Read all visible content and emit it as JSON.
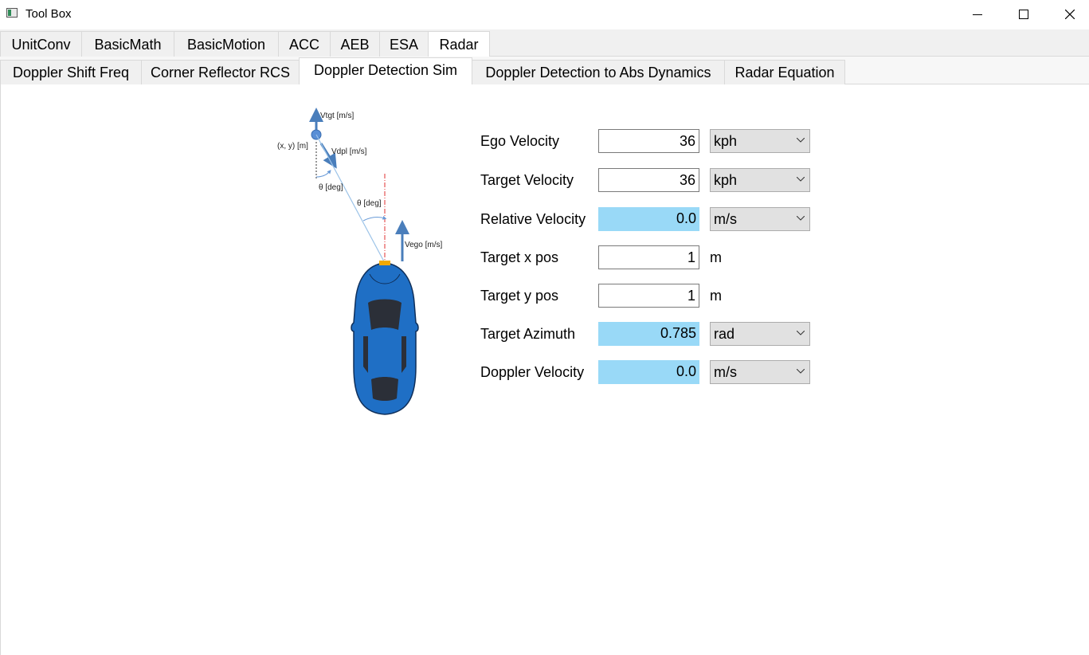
{
  "window": {
    "title": "Tool Box"
  },
  "main_tabs": [
    {
      "label": "UnitConv"
    },
    {
      "label": "BasicMath"
    },
    {
      "label": "BasicMotion"
    },
    {
      "label": "ACC"
    },
    {
      "label": "AEB"
    },
    {
      "label": "ESA"
    },
    {
      "label": "Radar",
      "active": true
    }
  ],
  "sub_tabs": [
    {
      "label": "Doppler Shift Freq"
    },
    {
      "label": "Corner Reflector RCS"
    },
    {
      "label": "Doppler Detection Sim",
      "active": true
    },
    {
      "label": "Doppler Detection to Abs Dynamics"
    },
    {
      "label": "Radar Equation"
    }
  ],
  "diagram": {
    "vtgt_label": "Vtgt [m/s]",
    "xy_label": "(x, y) [m]",
    "vdpl_label": "Vdpl [m/s]",
    "theta1_label": "θ [deg]",
    "theta2_label": "θ [deg]",
    "vego_label": "Vego [m/s]",
    "car_color": "#1f6fc5",
    "arrow_color": "#4a7ebb"
  },
  "form": {
    "ego_velocity": {
      "label": "Ego Velocity",
      "value": "36",
      "unit": "kph"
    },
    "target_velocity": {
      "label": "Target Velocity",
      "value": "36",
      "unit": "kph"
    },
    "relative_velocity": {
      "label": "Relative Velocity",
      "value": "0.0",
      "unit": "m/s"
    },
    "target_x": {
      "label": "Target x pos",
      "value": "1",
      "unit": "m"
    },
    "target_y": {
      "label": "Target y pos",
      "value": "1",
      "unit": "m"
    },
    "target_azimuth": {
      "label": "Target Azimuth",
      "value": "0.785",
      "unit": "rad"
    },
    "doppler_velocity": {
      "label": "Doppler Velocity",
      "value": "0.0",
      "unit": "m/s"
    }
  },
  "colors": {
    "readonly_field": "#99d9f7",
    "combo_bg": "#e1e1e1"
  }
}
